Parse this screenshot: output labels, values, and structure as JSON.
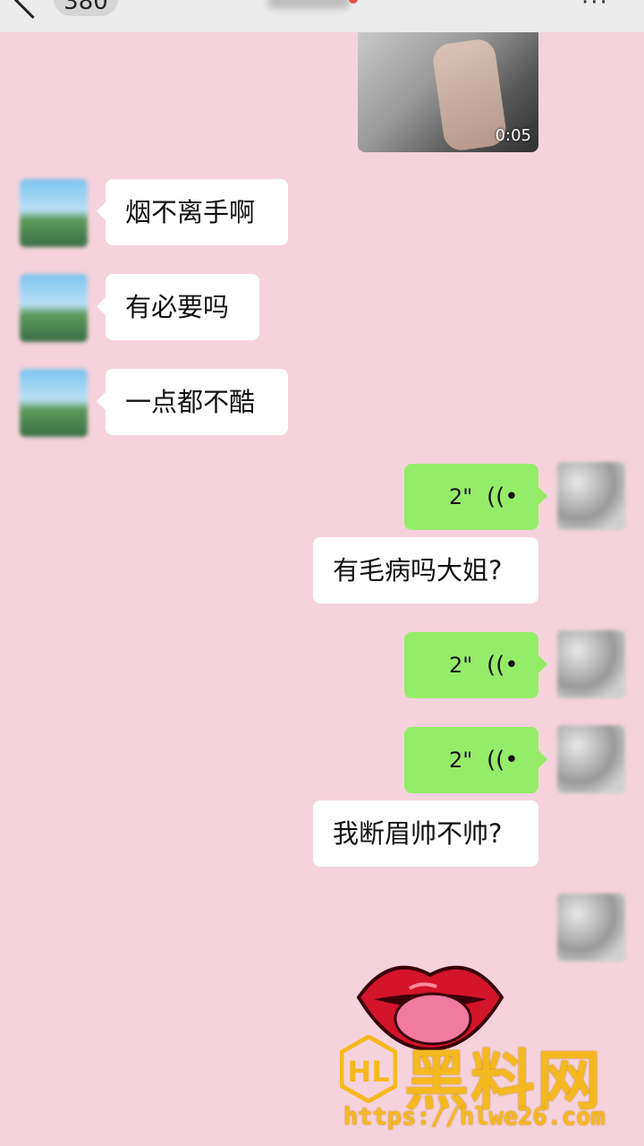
{
  "header": {
    "unread_count": "380",
    "more_label": "···"
  },
  "video": {
    "duration": "0:05"
  },
  "messages": [
    {
      "side": "left",
      "type": "text",
      "text": "烟不离手啊"
    },
    {
      "side": "left",
      "type": "text",
      "text": "有必要吗"
    },
    {
      "side": "left",
      "type": "text",
      "text": "一点都不酷"
    },
    {
      "side": "right",
      "type": "voice",
      "duration": "2\"",
      "icon": "voice-wave-icon"
    },
    {
      "side": "right",
      "type": "text",
      "text": "有毛病吗大姐?"
    },
    {
      "side": "right",
      "type": "voice",
      "duration": "2\"",
      "icon": "voice-wave-icon"
    },
    {
      "side": "right",
      "type": "voice",
      "duration": "2\"",
      "icon": "voice-wave-icon"
    },
    {
      "side": "right",
      "type": "text",
      "text": "我断眉帅不帅?"
    }
  ],
  "voice_glyph": "((•",
  "watermark": {
    "brand": "黑料网",
    "url": "https://hlwe26.com"
  },
  "colors": {
    "background": "#f6d3dc",
    "voice_bubble": "#95ec69",
    "text_bubble": "#ffffff",
    "watermark": "#f5b920"
  }
}
